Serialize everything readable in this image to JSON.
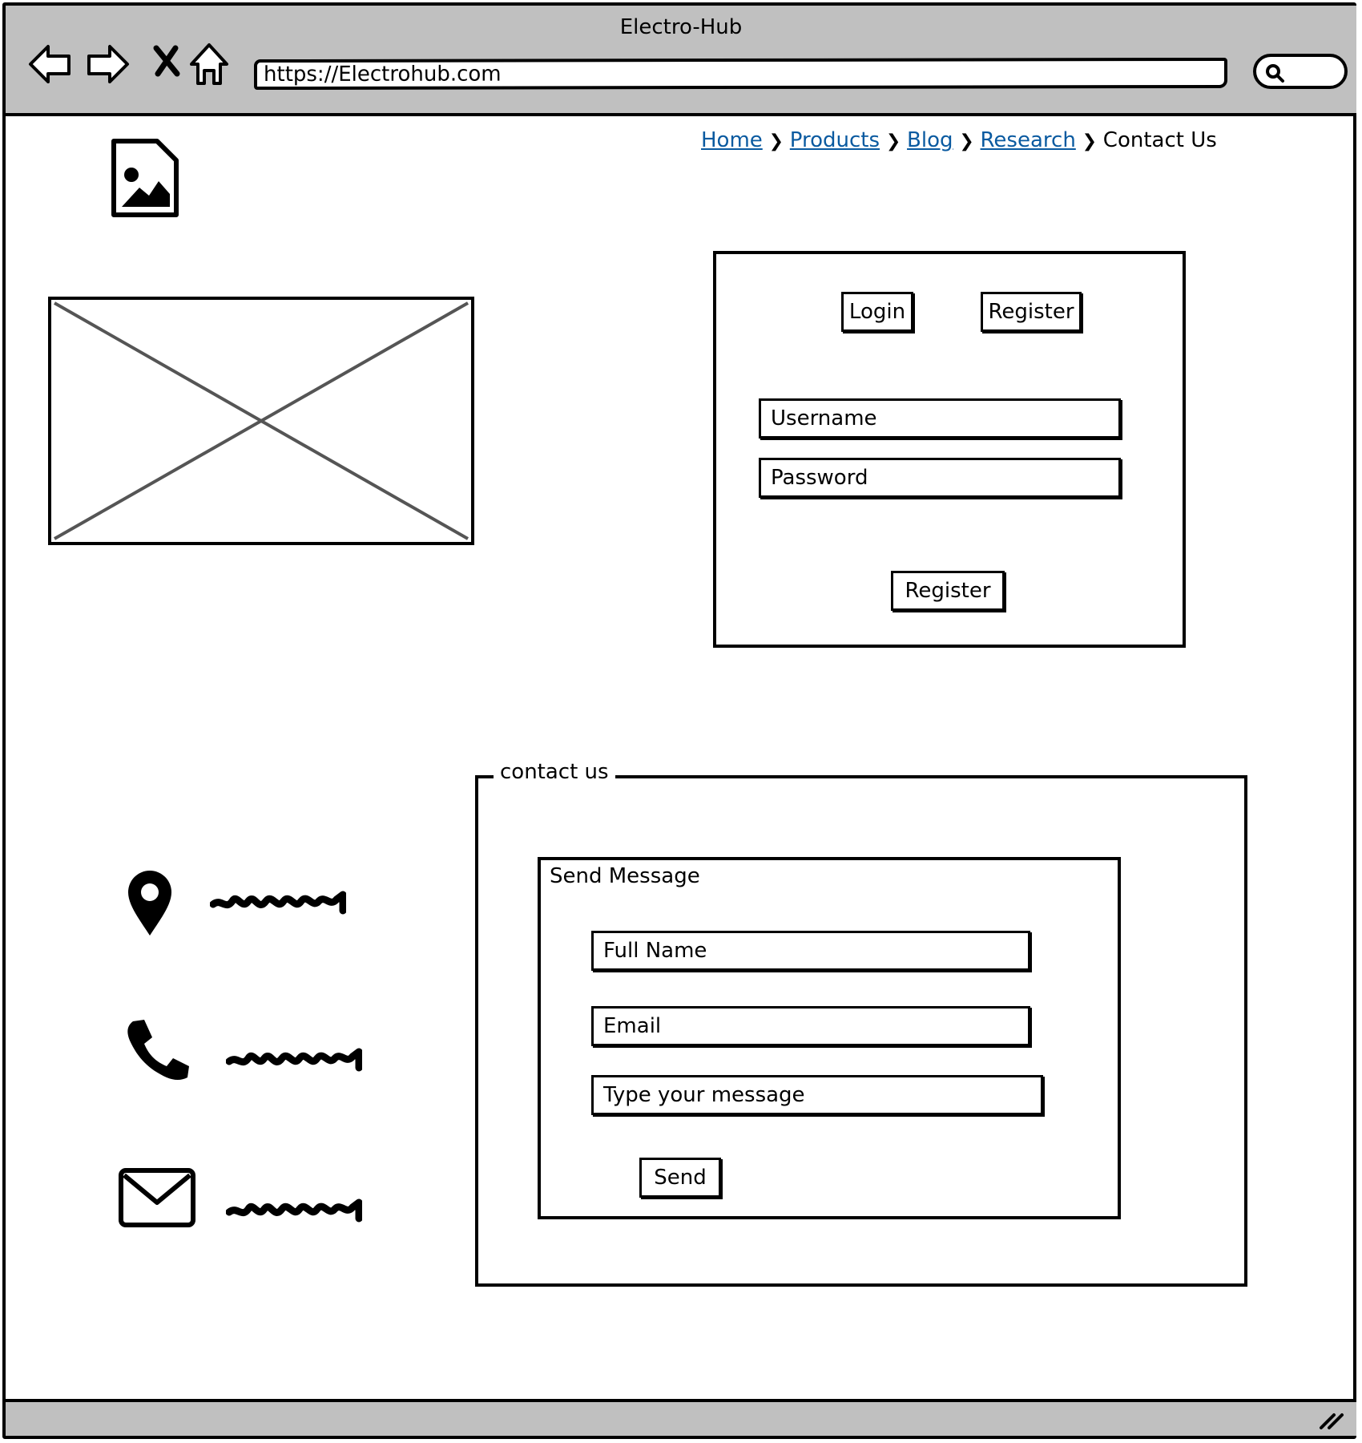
{
  "browser": {
    "window_title": "Electro-Hub",
    "url": "https://Electrohub.com",
    "icons": [
      "back-icon",
      "forward-icon",
      "stop-icon",
      "home-icon",
      "search-icon",
      "resize-grip-icon"
    ]
  },
  "breadcrumb": {
    "items": [
      "Home",
      "Products",
      "Blog",
      "Research"
    ],
    "current": "Contact Us"
  },
  "auth_panel": {
    "login_tab": "Login",
    "register_tab": "Register",
    "username_placeholder": "Username",
    "password_placeholder": "Password",
    "submit_label": "Register"
  },
  "contact": {
    "legend": "contact us",
    "panel_title": "Send Message",
    "full_name_placeholder": "Full Name",
    "email_placeholder": "Email",
    "message_placeholder": "Type your message",
    "send_label": "Send",
    "info_icons": [
      "location-pin-icon",
      "phone-icon",
      "envelope-icon"
    ]
  }
}
